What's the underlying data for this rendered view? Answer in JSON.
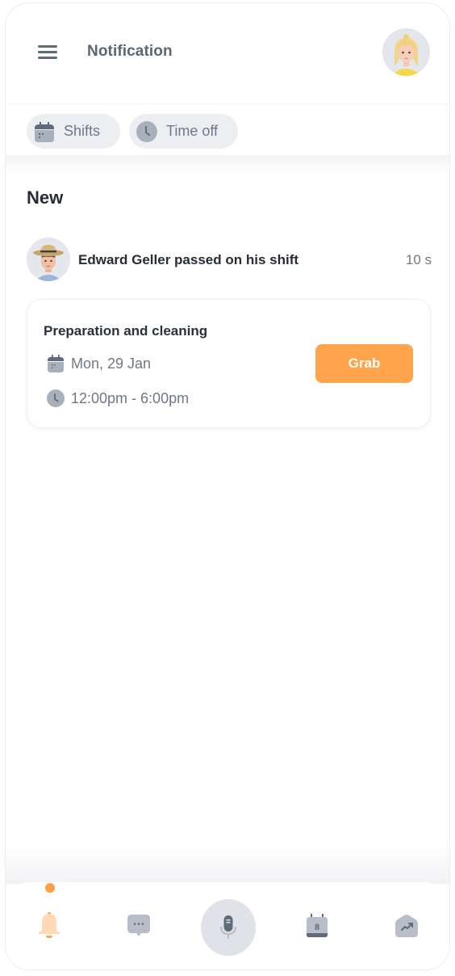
{
  "header": {
    "title": "Notification",
    "menu_icon": "menu-icon",
    "user_avatar": "user-avatar"
  },
  "filters": {
    "chips": [
      {
        "label": "Shifts",
        "icon": "calendar-icon"
      },
      {
        "label": "Time off",
        "icon": "clock-icon"
      }
    ]
  },
  "section": {
    "title": "New"
  },
  "notification": {
    "sender_avatar": "edward-avatar",
    "text": "Edward Geller passed on his shift",
    "time": "10 s"
  },
  "shift_card": {
    "title": "Preparation and cleaning",
    "date": "Mon, 29 Jan",
    "time_range": "12:00pm - 6:00pm",
    "action_label": "Grab"
  },
  "bottom_nav": {
    "items": [
      {
        "name": "notifications",
        "icon": "bell-icon",
        "active": true
      },
      {
        "name": "messages",
        "icon": "chat-icon",
        "active": false
      },
      {
        "name": "voice",
        "icon": "microphone-icon",
        "active": false
      },
      {
        "name": "calendar",
        "icon": "calendar-icon",
        "badge": "8",
        "active": false
      },
      {
        "name": "stats",
        "icon": "trending-up-icon",
        "active": false
      }
    ]
  },
  "colors": {
    "accent": "#ffa44a",
    "active_dot": "#ff9f43",
    "text_primary": "#262d36",
    "text_secondary": "#6e7886",
    "chip_bg": "#eceef1"
  }
}
